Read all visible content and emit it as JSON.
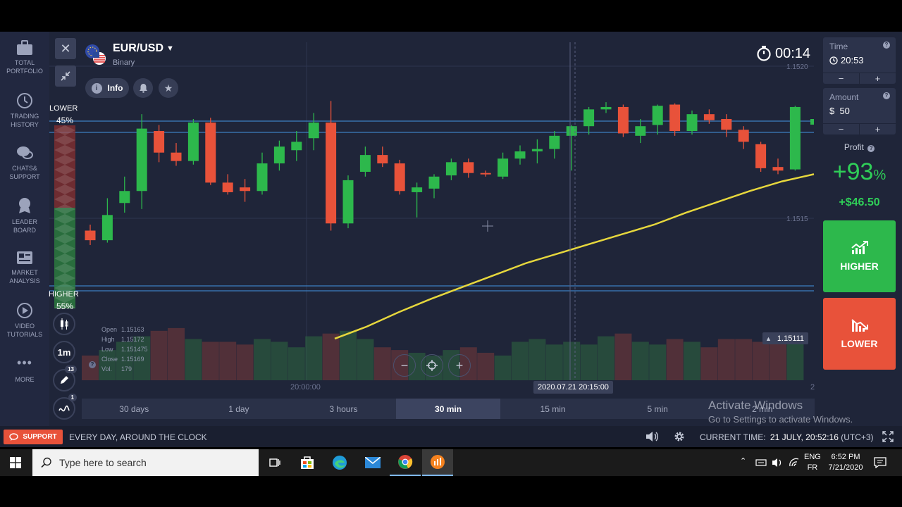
{
  "sidebar": {
    "items": [
      {
        "label1": "TOTAL",
        "label2": "PORTFOLIO"
      },
      {
        "label1": "TRADING",
        "label2": "HISTORY"
      },
      {
        "label1": "CHATS&",
        "label2": "SUPPORT"
      },
      {
        "label1": "LEADER",
        "label2": "BOARD"
      },
      {
        "label1": "MARKET",
        "label2": "ANALYSIS"
      },
      {
        "label1": "VIDEO",
        "label2": "TUTORIALS"
      },
      {
        "label1": "MORE",
        "label2": ""
      }
    ]
  },
  "asset": {
    "name": "EUR/USD",
    "type": "Binary"
  },
  "info_label": "Info",
  "timer": "00:14",
  "sentiment": {
    "lower_label": "LOWER",
    "lower_pct": "45%",
    "higher_label": "HIGHER",
    "higher_pct": "55%"
  },
  "chart_data": {
    "type": "candlestick",
    "price_axis_labels": [
      "1.1520",
      "1.1515"
    ],
    "current_price": "1.15111",
    "ohlc": {
      "open_label": "Open",
      "open": "1.15163",
      "high_label": "High",
      "high": "1.15172",
      "low_label": "Low",
      "low": "1.151475",
      "close_label": "Close",
      "close": "1.15169",
      "vol_label": "Vol.",
      "vol": "179"
    },
    "x_label_left": "20:00:00",
    "x_label_cursor": "2020.07.21 20:15:00",
    "x_label_right": "2",
    "up_color": "#2db84c",
    "down_color": "#e8523a",
    "ma_color": "#e6d73d",
    "candles": [
      {
        "o": 1.1511,
        "h": 1.15115,
        "l": 1.15098,
        "c": 1.15102
      },
      {
        "o": 1.15102,
        "h": 1.15137,
        "l": 1.151,
        "c": 1.15123
      },
      {
        "o": 1.15133,
        "h": 1.15155,
        "l": 1.15125,
        "c": 1.15143
      },
      {
        "o": 1.15143,
        "h": 1.15207,
        "l": 1.15128,
        "c": 1.15195
      },
      {
        "o": 1.15193,
        "h": 1.15198,
        "l": 1.15167,
        "c": 1.15175
      },
      {
        "o": 1.15175,
        "h": 1.15183,
        "l": 1.15164,
        "c": 1.15168
      },
      {
        "o": 1.15168,
        "h": 1.15203,
        "l": 1.15165,
        "c": 1.152
      },
      {
        "o": 1.152,
        "h": 1.15204,
        "l": 1.15148,
        "c": 1.1515
      },
      {
        "o": 1.1515,
        "h": 1.15157,
        "l": 1.1514,
        "c": 1.15142
      },
      {
        "o": 1.15146,
        "h": 1.15153,
        "l": 1.15134,
        "c": 1.15143
      },
      {
        "o": 1.15143,
        "h": 1.15175,
        "l": 1.1514,
        "c": 1.15166
      },
      {
        "o": 1.15166,
        "h": 1.15185,
        "l": 1.1516,
        "c": 1.1518
      },
      {
        "o": 1.15177,
        "h": 1.15193,
        "l": 1.15168,
        "c": 1.15184
      },
      {
        "o": 1.15187,
        "h": 1.15208,
        "l": 1.15177,
        "c": 1.152
      },
      {
        "o": 1.152,
        "h": 1.15218,
        "l": 1.1511,
        "c": 1.15116
      },
      {
        "o": 1.15116,
        "h": 1.15156,
        "l": 1.15112,
        "c": 1.15152
      },
      {
        "o": 1.15159,
        "h": 1.1518,
        "l": 1.15155,
        "c": 1.15173
      },
      {
        "o": 1.15173,
        "h": 1.1518,
        "l": 1.15163,
        "c": 1.15166
      },
      {
        "o": 1.15166,
        "h": 1.15169,
        "l": 1.1514,
        "c": 1.15143
      },
      {
        "o": 1.15142,
        "h": 1.1515,
        "l": 1.15121,
        "c": 1.15146
      },
      {
        "o": 1.15145,
        "h": 1.15157,
        "l": 1.15137,
        "c": 1.15155
      },
      {
        "o": 1.15156,
        "h": 1.1517,
        "l": 1.15152,
        "c": 1.15167
      },
      {
        "o": 1.15167,
        "h": 1.1517,
        "l": 1.15154,
        "c": 1.15158
      },
      {
        "o": 1.15158,
        "h": 1.1516,
        "l": 1.15155,
        "c": 1.15157
      },
      {
        "o": 1.15155,
        "h": 1.15175,
        "l": 1.15153,
        "c": 1.1517
      },
      {
        "o": 1.1517,
        "h": 1.15181,
        "l": 1.15165,
        "c": 1.15176
      },
      {
        "o": 1.15176,
        "h": 1.15186,
        "l": 1.15166,
        "c": 1.15178
      },
      {
        "o": 1.15178,
        "h": 1.15193,
        "l": 1.1517,
        "c": 1.15189
      },
      {
        "o": 1.15189,
        "h": 1.15198,
        "l": 1.1516,
        "c": 1.15197
      },
      {
        "o": 1.15197,
        "h": 1.15213,
        "l": 1.1519,
        "c": 1.15211
      },
      {
        "o": 1.15211,
        "h": 1.15217,
        "l": 1.15208,
        "c": 1.15213
      },
      {
        "o": 1.15213,
        "h": 1.15215,
        "l": 1.15188,
        "c": 1.15191
      },
      {
        "o": 1.15189,
        "h": 1.15203,
        "l": 1.15183,
        "c": 1.15197
      },
      {
        "o": 1.15198,
        "h": 1.15215,
        "l": 1.1519,
        "c": 1.15214
      },
      {
        "o": 1.15215,
        "h": 1.15216,
        "l": 1.15189,
        "c": 1.15193
      },
      {
        "o": 1.15193,
        "h": 1.1521,
        "l": 1.1519,
        "c": 1.15207
      },
      {
        "o": 1.15207,
        "h": 1.15211,
        "l": 1.15199,
        "c": 1.15202
      },
      {
        "o": 1.15203,
        "h": 1.15207,
        "l": 1.15188,
        "c": 1.15194
      },
      {
        "o": 1.15194,
        "h": 1.15197,
        "l": 1.15178,
        "c": 1.15184
      },
      {
        "o": 1.15182,
        "h": 1.15184,
        "l": 1.15159,
        "c": 1.15162
      },
      {
        "o": 1.15163,
        "h": 1.1517,
        "l": 1.15157,
        "c": 1.1516
      },
      {
        "o": 1.15161,
        "h": 1.15214,
        "l": 1.1516,
        "c": 1.15213
      }
    ],
    "ma": [
      1.1502,
      1.1503,
      1.15042,
      1.15053,
      1.15063,
      1.15073,
      1.15083,
      1.15091,
      1.15099,
      1.15107,
      1.15115,
      1.15125,
      1.15134,
      1.15143,
      1.15151,
      1.15157
    ],
    "volume_levels": [
      0.45,
      0.55,
      0.7,
      0.8,
      0.9,
      0.95,
      0.75,
      0.7,
      0.7,
      0.65,
      0.75,
      0.7,
      0.6,
      0.8,
      0.85,
      0.9,
      0.75,
      0.6,
      0.55,
      0.5,
      0.45,
      0.55,
      0.6,
      0.5,
      0.45,
      0.7,
      0.75,
      0.65,
      0.7,
      0.65,
      0.8,
      0.85,
      0.7,
      0.65,
      0.75,
      0.7,
      0.6,
      0.75,
      0.75,
      0.7,
      0.75,
      0.8
    ]
  },
  "timeframes": [
    "30 days",
    "1 day",
    "3 hours",
    "30 min",
    "15 min",
    "5 min",
    "2 min"
  ],
  "active_timeframe": "30 min",
  "tools": {
    "candle_interval": "1m",
    "draw_badge": "13",
    "indicator_badge": "1"
  },
  "right_panel": {
    "time_label": "Time",
    "time_value": "20:53",
    "amount_label": "Amount",
    "amount_value": "$  50",
    "minus": "−",
    "plus": "+",
    "profit_label": "Profit",
    "profit_pct": "+93",
    "profit_pct_sign": "%",
    "profit_amount": "+$46.50",
    "higher_label": "HIGHER",
    "lower_label": "LOWER",
    "higher_color": "#2db84c",
    "lower_color": "#e8523a"
  },
  "bottom_bar": {
    "support_label": "SUPPORT",
    "support_text": "EVERY DAY, AROUND THE CLOCK",
    "current_time_label": "CURRENT TIME:",
    "current_time_value": "21 JULY, 20:52:16",
    "timezone": "(UTC+3)"
  },
  "watermark": {
    "line1": "Activate Windows",
    "line2": "Go to Settings to activate Windows."
  },
  "taskbar": {
    "search_placeholder": "Type here to search",
    "lang1": "ENG",
    "lang2": "FR",
    "clock_time": "6:52 PM",
    "clock_date": "7/21/2020"
  }
}
